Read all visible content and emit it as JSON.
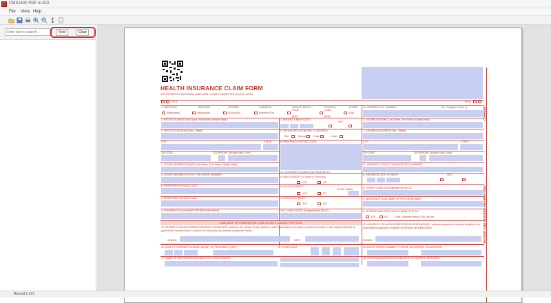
{
  "window": {
    "title": "CMS1500 PDF to EDI"
  },
  "menu": {
    "items": [
      "File",
      "View",
      "Help"
    ]
  },
  "toolbar": {
    "icons": [
      "open-icon",
      "save-icon",
      "print-icon",
      "zoom-in-icon",
      "zoom-out-icon",
      "fit-icon",
      "page-icon"
    ]
  },
  "sidebar": {
    "search_placeholder": "Enter text to search ...",
    "find_label": "Find",
    "clear_label": "Clear"
  },
  "statusbar": {
    "page_text": "Record 1 of 5"
  },
  "form": {
    "title": "HEALTH INSURANCE CLAIM FORM",
    "approved": "APPROVED BY NATIONAL UNIFORM CLAIM COMMITTEE (NUCC) 02/12",
    "carrier_label": "CARRIER",
    "patient_label": "PATIENT AND INSURED INFORMATION",
    "pica_left": "PICA",
    "pica_right": "PICA",
    "row1": {
      "medicare": "1. MEDICARE",
      "medicaid": "MEDICAID",
      "tricare": "TRICARE",
      "champva": "CHAMPVA",
      "group": "GROUP HEALTH PLAN",
      "feca": "FECA BLK LUNG",
      "other": "OTHER",
      "insured_id": "1a. INSURED'S I.D. NUMBER",
      "program": "(For Program in Item 1)"
    },
    "row1_sub": {
      "medicare": "(Medicare#)",
      "medicaid": "(Medicaid#)",
      "tricare": "(ID#/DoD#)",
      "champva": "(Member ID#)",
      "group": "(ID#)",
      "feca": "(ID#)",
      "other": "(ID#)"
    },
    "f2": "2. PATIENT'S NAME (Last Name, First Name, Middle Initial)",
    "f3": "3. PATIENT'S BIRTH DATE",
    "f3_sex": "SEX",
    "f4": "4. INSURED'S NAME (Last Name, First Name, Middle Initial)",
    "f5": "5. PATIENT'S ADDRESS (No., Street)",
    "f6": "6. PATIENT RELATIONSHIP TO INSURED",
    "f6_opts": [
      "Self",
      "Spouse",
      "Child",
      "Other"
    ],
    "f7": "7. INSURED'S ADDRESS (No., Street)",
    "city": "CITY",
    "state": "STATE",
    "f8": "8. RESERVED FOR NUCC USE",
    "zip": "ZIP CODE",
    "tel": "TELEPHONE (Include Area Code)",
    "f9": "9. OTHER INSURED'S NAME (Last Name, First Name, Middle Initial)",
    "f10": "10. IS PATIENT'S CONDITION RELATED TO:",
    "f11": "11. INSURED'S POLICY GROUP OR FECA NUMBER",
    "f9a": "a. OTHER INSURED'S POLICY OR GROUP NUMBER",
    "f10a": "a. EMPLOYMENT? (Current or Previous)",
    "f11a": "a. INSURED'S DATE OF BIRTH",
    "f9b": "b. RESERVED FOR NUCC USE",
    "f10b": "b. AUTO ACCIDENT?",
    "place": "PLACE (State)",
    "f11b": "b. OTHER CLAIM ID (Designated by NUCC)",
    "f9c": "c. RESERVED FOR NUCC USE",
    "f10c": "c. OTHER ACCIDENT?",
    "f11c": "c. INSURANCE PLAN NAME OR PROGRAM NAME",
    "f9d": "d. INSURANCE PLAN NAME OR PROGRAM NAME",
    "f10d": "10d. CLAIM CODES (Designated by NUCC)",
    "f11d": "d. IS THERE ANOTHER HEALTH BENEFIT PLAN?",
    "f11d_note": "If yes, complete items 9, 9a, and 9d.",
    "yes": "YES",
    "no": "NO",
    "readback": "READ BACK OF FORM BEFORE COMPLETING & SIGNING THIS FORM.",
    "f12": "12. PATIENT'S OR AUTHORIZED PERSON'S SIGNATURE I authorize the release of any medical or other information necessary to process this claim. I also request payment of government benefits either to myself or to the party who accepts assignment below.",
    "f13": "13. INSURED'S OR AUTHORIZED PERSON'S SIGNATURE I authorize payment of medical benefits to the undersigned physician or supplier for services described below.",
    "signed": "SIGNED",
    "date": "DATE",
    "f14": "14. DATE OF CURRENT ILLNESS, INJURY, or PREGNANCY (LMP)",
    "f15": "15. OTHER DATE",
    "f16": "16. DATES PATIENT UNABLE TO WORK IN CURRENT OCCUPATION",
    "f17": "17. NAME OF REFERRING PROVIDER OR OTHER SOURCE",
    "f18": "18. HOSPITALIZATION DATES RELATED TO CURRENT SERVICES"
  }
}
